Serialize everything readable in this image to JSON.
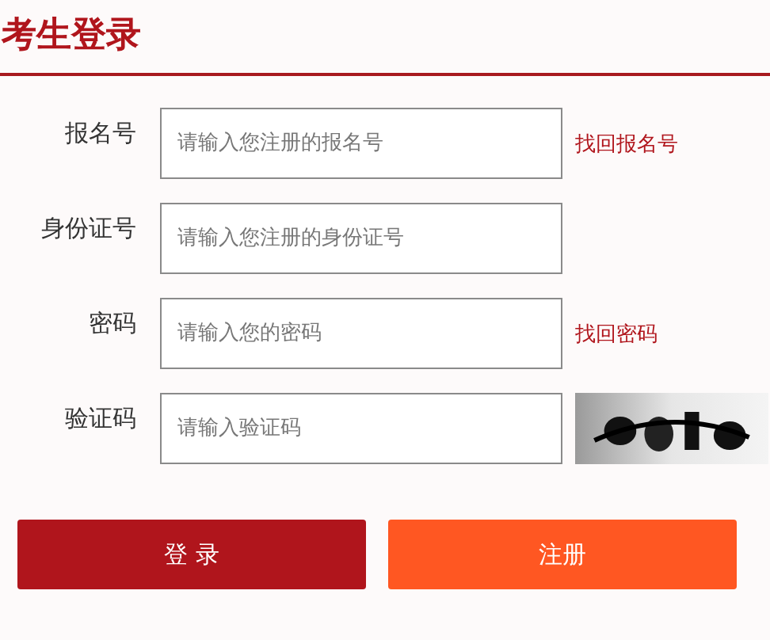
{
  "title": "考生登录",
  "fields": [
    {
      "label": "报名号",
      "placeholder": "请输入您注册的报名号",
      "kind": "link",
      "link": "找回报名号"
    },
    {
      "label": "身份证号",
      "placeholder": "请输入您注册的身份证号",
      "kind": "plain"
    },
    {
      "label": "密码",
      "placeholder": "请输入您的密码",
      "kind": "link",
      "link": "找回密码"
    },
    {
      "label": "验证码",
      "placeholder": "请输入验证码",
      "kind": "captcha"
    }
  ],
  "buttons": [
    {
      "label": "登 录",
      "kind": "primary"
    },
    {
      "label": "注册",
      "kind": "secondary"
    }
  ]
}
